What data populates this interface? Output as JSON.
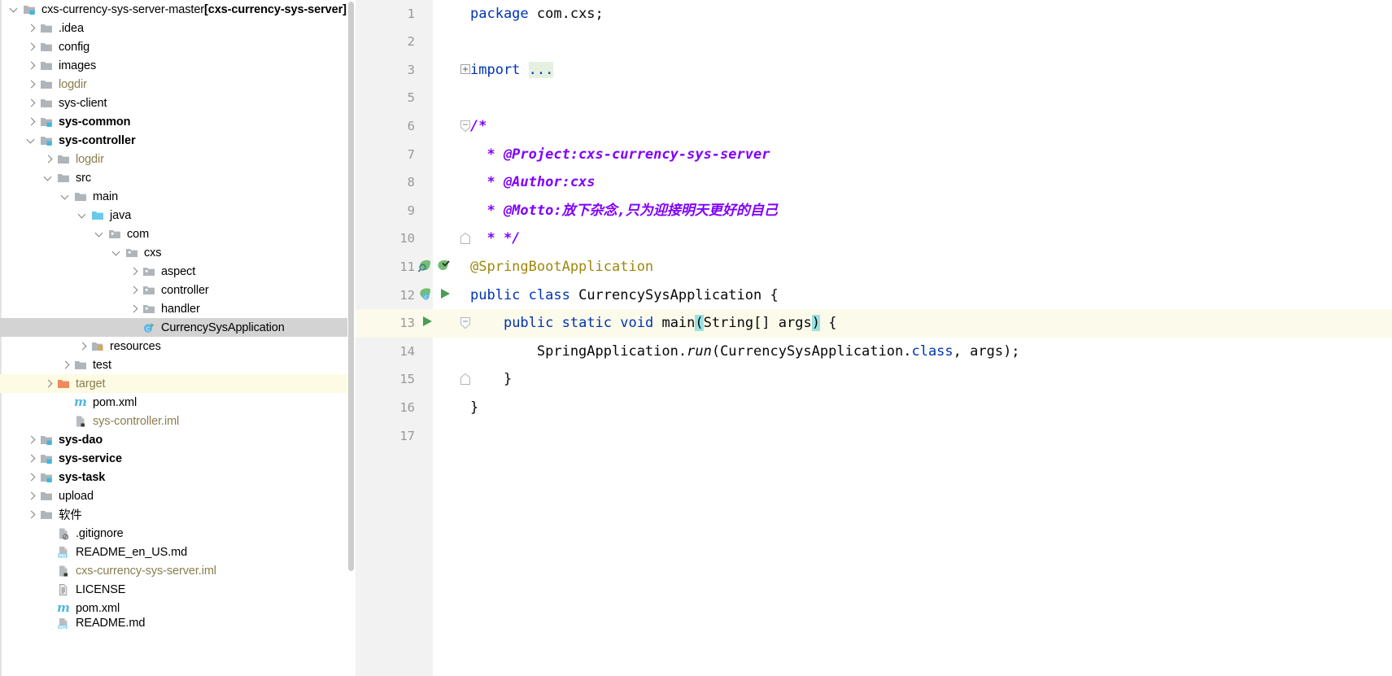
{
  "window": {
    "title": "cxs-currency-sys-server-master"
  },
  "tree": {
    "name": "project-tree",
    "scrollbar": {
      "name": "tree-vertical-scrollbar"
    },
    "items": [
      {
        "label": "cxs-currency-sys-server-master ",
        "suffix": "[cxs-currency-sys-server]",
        "depth": 0,
        "arrow": "down",
        "icon": "module-folder-icon",
        "style": "normal",
        "state": "normal"
      },
      {
        "label": ".idea",
        "suffix": "",
        "depth": 1,
        "arrow": "right",
        "icon": "folder-icon",
        "style": "normal",
        "state": "normal"
      },
      {
        "label": "config",
        "suffix": "",
        "depth": 1,
        "arrow": "right",
        "icon": "folder-icon",
        "style": "normal",
        "state": "normal"
      },
      {
        "label": "images",
        "suffix": "",
        "depth": 1,
        "arrow": "right",
        "icon": "folder-icon",
        "style": "normal",
        "state": "normal"
      },
      {
        "label": "logdir",
        "suffix": "",
        "depth": 1,
        "arrow": "right",
        "icon": "folder-icon",
        "style": "muted",
        "state": "normal"
      },
      {
        "label": "sys-client",
        "suffix": "",
        "depth": 1,
        "arrow": "right",
        "icon": "folder-icon",
        "style": "normal",
        "state": "normal"
      },
      {
        "label": "sys-common",
        "suffix": "",
        "depth": 1,
        "arrow": "right",
        "icon": "module-folder-icon",
        "style": "bold",
        "state": "normal"
      },
      {
        "label": "sys-controller",
        "suffix": "",
        "depth": 1,
        "arrow": "down",
        "icon": "module-folder-icon",
        "style": "bold",
        "state": "normal"
      },
      {
        "label": "logdir",
        "suffix": "",
        "depth": 2,
        "arrow": "right",
        "icon": "folder-icon",
        "style": "muted",
        "state": "normal"
      },
      {
        "label": "src",
        "suffix": "",
        "depth": 2,
        "arrow": "down",
        "icon": "folder-icon",
        "style": "normal",
        "state": "normal"
      },
      {
        "label": "main",
        "suffix": "",
        "depth": 3,
        "arrow": "down",
        "icon": "folder-icon",
        "style": "normal",
        "state": "normal"
      },
      {
        "label": "java",
        "suffix": "",
        "depth": 4,
        "arrow": "down",
        "icon": "source-root-icon",
        "style": "normal",
        "state": "normal"
      },
      {
        "label": "com",
        "suffix": "",
        "depth": 5,
        "arrow": "down",
        "icon": "package-icon",
        "style": "normal",
        "state": "normal"
      },
      {
        "label": "cxs",
        "suffix": "",
        "depth": 6,
        "arrow": "down",
        "icon": "package-icon",
        "style": "normal",
        "state": "normal"
      },
      {
        "label": "aspect",
        "suffix": "",
        "depth": 7,
        "arrow": "right",
        "icon": "package-icon",
        "style": "normal",
        "state": "normal"
      },
      {
        "label": "controller",
        "suffix": "",
        "depth": 7,
        "arrow": "right",
        "icon": "package-icon",
        "style": "normal",
        "state": "normal"
      },
      {
        "label": "handler",
        "suffix": "",
        "depth": 7,
        "arrow": "right",
        "icon": "package-icon",
        "style": "normal",
        "state": "normal"
      },
      {
        "label": "CurrencySysApplication",
        "suffix": "",
        "depth": 7,
        "arrow": "none",
        "icon": "java-class-run-icon",
        "style": "normal",
        "state": "selected"
      },
      {
        "label": "resources",
        "suffix": "",
        "depth": 4,
        "arrow": "right",
        "icon": "resources-folder-icon",
        "style": "normal",
        "state": "normal"
      },
      {
        "label": "test",
        "suffix": "",
        "depth": 3,
        "arrow": "right",
        "icon": "folder-icon",
        "style": "normal",
        "state": "normal"
      },
      {
        "label": "target",
        "suffix": "",
        "depth": 2,
        "arrow": "right",
        "icon": "excluded-folder-icon",
        "style": "orange-txt",
        "state": "highlighted"
      },
      {
        "label": "pom.xml",
        "suffix": "",
        "depth": 3,
        "arrow": "none",
        "icon": "maven-pom-icon",
        "style": "normal",
        "state": "normal"
      },
      {
        "label": "sys-controller.iml",
        "suffix": "",
        "depth": 3,
        "arrow": "none",
        "icon": "iml-file-icon",
        "style": "muted",
        "state": "normal"
      },
      {
        "label": "sys-dao",
        "suffix": "",
        "depth": 1,
        "arrow": "right",
        "icon": "module-folder-icon",
        "style": "bold",
        "state": "normal"
      },
      {
        "label": "sys-service",
        "suffix": "",
        "depth": 1,
        "arrow": "right",
        "icon": "module-folder-icon",
        "style": "bold",
        "state": "normal"
      },
      {
        "label": "sys-task",
        "suffix": "",
        "depth": 1,
        "arrow": "right",
        "icon": "module-folder-icon",
        "style": "bold",
        "state": "normal"
      },
      {
        "label": "upload",
        "suffix": "",
        "depth": 1,
        "arrow": "right",
        "icon": "folder-icon",
        "style": "normal",
        "state": "normal"
      },
      {
        "label": "软件",
        "suffix": "",
        "depth": 1,
        "arrow": "right",
        "icon": "folder-icon",
        "style": "normal",
        "state": "normal"
      },
      {
        "label": ".gitignore",
        "suffix": "",
        "depth": 2,
        "arrow": "none",
        "icon": "gitignore-file-icon",
        "style": "normal",
        "state": "normal"
      },
      {
        "label": "README_en_US.md",
        "suffix": "",
        "depth": 2,
        "arrow": "none",
        "icon": "markdown-file-icon",
        "style": "normal",
        "state": "normal"
      },
      {
        "label": "cxs-currency-sys-server.iml",
        "suffix": "",
        "depth": 2,
        "arrow": "none",
        "icon": "iml-file-icon",
        "style": "muted",
        "state": "normal"
      },
      {
        "label": "LICENSE",
        "suffix": "",
        "depth": 2,
        "arrow": "none",
        "icon": "text-file-icon",
        "style": "normal",
        "state": "normal"
      },
      {
        "label": "pom.xml",
        "suffix": "",
        "depth": 2,
        "arrow": "none",
        "icon": "maven-pom-icon",
        "style": "normal",
        "state": "normal"
      },
      {
        "label": "README.md",
        "suffix": "",
        "depth": 2,
        "arrow": "none",
        "icon": "markdown-file-icon",
        "style": "normal",
        "state": "partial"
      }
    ]
  },
  "editor": {
    "name": "code-editor",
    "file": "CurrencySysApplication.java",
    "current_line": 13,
    "lines": [
      {
        "num": "1",
        "fold": "none",
        "icons": [],
        "tokens": [
          {
            "t": "package ",
            "c": "kw"
          },
          {
            "t": "com.cxs;",
            "c": "plain"
          }
        ]
      },
      {
        "num": "2",
        "fold": "none",
        "icons": [],
        "tokens": []
      },
      {
        "num": "3",
        "fold": "plus",
        "icons": [],
        "tokens": [
          {
            "t": "import ",
            "c": "kw"
          },
          {
            "t": "...",
            "c": "foldhl"
          }
        ]
      },
      {
        "num": "5",
        "fold": "none",
        "icons": [],
        "tokens": []
      },
      {
        "num": "6",
        "fold": "start",
        "icons": [],
        "tokens": [
          {
            "t": "/*",
            "c": "cmt"
          }
        ]
      },
      {
        "num": "7",
        "fold": "none",
        "icons": [],
        "tokens": [
          {
            "t": "  * @Project:cxs-currency-sys-server",
            "c": "cmt"
          }
        ]
      },
      {
        "num": "8",
        "fold": "none",
        "icons": [],
        "tokens": [
          {
            "t": "  * @Author:cxs",
            "c": "cmt"
          }
        ]
      },
      {
        "num": "9",
        "fold": "none",
        "icons": [],
        "tokens": [
          {
            "t": "  * @Motto:放下杂念,只为迎接明天更好的自己",
            "c": "cmt"
          }
        ]
      },
      {
        "num": "10",
        "fold": "end",
        "icons": [],
        "tokens": [
          {
            "t": "  * */",
            "c": "cmt"
          }
        ]
      },
      {
        "num": "11",
        "fold": "none",
        "icons": [
          "spring-bean-search-icon",
          "spring-bean-check-icon"
        ],
        "tokens": [
          {
            "t": "@SpringBootApplication",
            "c": "ann"
          }
        ]
      },
      {
        "num": "12",
        "fold": "none",
        "icons": [
          "spring-bean-icon",
          "run-class-icon"
        ],
        "tokens": [
          {
            "t": "public ",
            "c": "kw"
          },
          {
            "t": "class ",
            "c": "kw"
          },
          {
            "t": "CurrencySysApplication {",
            "c": "plain"
          }
        ]
      },
      {
        "num": "13",
        "fold": "start",
        "icons": [
          "run-method-icon"
        ],
        "tokens": [
          {
            "t": "    ",
            "c": "plain"
          },
          {
            "t": "public ",
            "c": "kw"
          },
          {
            "t": "static ",
            "c": "kw"
          },
          {
            "t": "void ",
            "c": "kw"
          },
          {
            "t": "main",
            "c": "plain"
          },
          {
            "t": "(",
            "c": "brk"
          },
          {
            "t": "String[] args",
            "c": "plain"
          },
          {
            "t": ")",
            "c": "brk"
          },
          {
            "t": " {",
            "c": "plain"
          }
        ]
      },
      {
        "num": "14",
        "fold": "none",
        "icons": [],
        "tokens": [
          {
            "t": "        SpringApplication.",
            "c": "plain"
          },
          {
            "t": "run",
            "c": "ital"
          },
          {
            "t": "(CurrencySysApplication.",
            "c": "plain"
          },
          {
            "t": "class",
            "c": "kw"
          },
          {
            "t": ", args);",
            "c": "plain"
          }
        ]
      },
      {
        "num": "15",
        "fold": "end",
        "icons": [],
        "tokens": [
          {
            "t": "    }",
            "c": "plain"
          }
        ]
      },
      {
        "num": "16",
        "fold": "none",
        "icons": [],
        "tokens": [
          {
            "t": "}",
            "c": "plain"
          }
        ]
      },
      {
        "num": "17",
        "fold": "none",
        "icons": [],
        "tokens": []
      }
    ]
  },
  "colors": {
    "keyword": "#0033b3",
    "comment": "#8000ff",
    "annotation": "#9e880d",
    "selection": "#d3d3d3",
    "caret_line": "#fcfaeb",
    "bracket_match": "#9ae2e2",
    "gutter_bg": "#f2f2f2",
    "folded_code": "#e5f0e0",
    "excluded_folder": "#8a7d4e"
  }
}
